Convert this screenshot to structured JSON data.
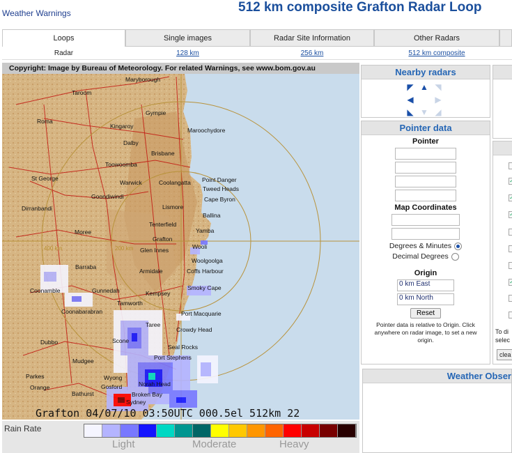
{
  "header": {
    "link": "Weather Warnings",
    "title": "512 km composite Grafton Radar Loop"
  },
  "tabs": [
    {
      "label": "Loops"
    },
    {
      "label": "Single images"
    },
    {
      "label": "Radar Site Information"
    },
    {
      "label": "Other Radars"
    }
  ],
  "subnav": {
    "current": "Radar",
    "links": [
      "128 km",
      "256 km",
      "512 km composite"
    ]
  },
  "radar": {
    "copyright": "Copyright: Image by Bureau of Meteorology. For related Warnings, see www.bom.gov.au",
    "stamp": "Grafton 04/07/10 03:50UTC 000.5el 512km 22",
    "ring_labels": [
      "400 km",
      "200 km"
    ],
    "places": [
      "Maryborough",
      "Taroom",
      "Gympie",
      "Roma",
      "Kingaroy",
      "Maroochydore",
      "Dalby",
      "Brisbane",
      "Toowoomba",
      "St George",
      "Warwick",
      "Coolangatta",
      "Point Danger",
      "Tweed Heads",
      "Goondiwindi",
      "Cape Byron",
      "Dirranbandi",
      "Lismore",
      "Ballina",
      "Tenterfield",
      "Yamba",
      "Moree",
      "Grafton",
      "Glen Innes",
      "Wooli",
      "Woolgoolga",
      "Barraba",
      "Armidale",
      "Coffs Harbour",
      "Coonamble",
      "Gunnedah",
      "Kempsey",
      "Smoky Cape",
      "Coonabarabran",
      "Tamworth",
      "Port Macquarie",
      "Taree",
      "Crowdy Head",
      "Dubbo",
      "Scone",
      "Seal Rocks",
      "Port Stephens",
      "Mudgee",
      "Parkes",
      "Wyong",
      "Norah Head",
      "Orange",
      "Gosford",
      "Broken Bay",
      "Bathurst",
      "Sydney"
    ]
  },
  "legend": {
    "title": "Rain Rate",
    "levels": [
      "Light",
      "Moderate",
      "Heavy"
    ],
    "colors": [
      "#f5f5ff",
      "#b4b4ff",
      "#7878ff",
      "#1414ff",
      "#00d8c3",
      "#009690",
      "#006666",
      "#ffff00",
      "#ffc800",
      "#ff9600",
      "#ff6400",
      "#ff0000",
      "#c80000",
      "#780000",
      "#280000"
    ]
  },
  "panels": {
    "nearby": {
      "title": "Nearby radars"
    },
    "pointer": {
      "title": "Pointer data",
      "pointer_label": "Pointer",
      "map_label": "Map Coordinates",
      "deg_min": "Degrees & Minutes",
      "decimal": "Decimal Degrees",
      "origin_label": "Origin",
      "east_value": "0 km East",
      "north_value": "0 km North",
      "reset": "Reset",
      "note": "Pointer data is relative to Origin. Click anywhere on radar image, to set a new origin."
    },
    "observations": {
      "title": "Weather Obser"
    },
    "side": {
      "text1": "To di",
      "text2": "selec",
      "btn": "clea"
    }
  },
  "colors": {
    "accent": "#2566b5",
    "title": "#1b4f9c",
    "land": "#d9b98a",
    "sea": "#c9dcec"
  }
}
